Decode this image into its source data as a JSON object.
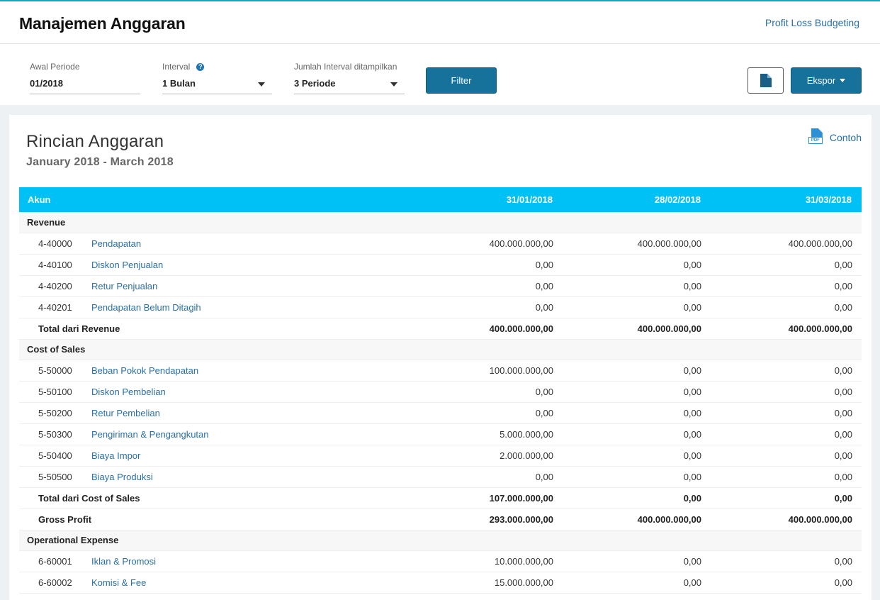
{
  "header": {
    "title": "Manajemen Anggaran",
    "link": "Profit Loss Budgeting"
  },
  "filters": {
    "awal_periode": {
      "label": "Awal Periode",
      "value": "01/2018"
    },
    "interval": {
      "label": "Interval",
      "value": "1 Bulan"
    },
    "jumlah_interval": {
      "label": "Jumlah Interval ditampilkan",
      "value": "3 Periode"
    },
    "filter_button": "Filter",
    "export_button": "Ekspor"
  },
  "report": {
    "title": "Rincian Anggaran",
    "subtitle": "January 2018 - March 2018",
    "sample_link": "Contoh",
    "columns": [
      "Akun",
      "31/01/2018",
      "28/02/2018",
      "31/03/2018"
    ],
    "sections": [
      {
        "name": "Revenue",
        "rows": [
          {
            "code": "4-40000",
            "name": "Pendapatan",
            "values": [
              "400.000.000,00",
              "400.000.000,00",
              "400.000.000,00"
            ]
          },
          {
            "code": "4-40100",
            "name": "Diskon Penjualan",
            "values": [
              "0,00",
              "0,00",
              "0,00"
            ]
          },
          {
            "code": "4-40200",
            "name": "Retur Penjualan",
            "values": [
              "0,00",
              "0,00",
              "0,00"
            ]
          },
          {
            "code": "4-40201",
            "name": "Pendapatan Belum Ditagih",
            "values": [
              "0,00",
              "0,00",
              "0,00"
            ]
          }
        ],
        "total": {
          "label": "Total dari Revenue",
          "values": [
            "400.000.000,00",
            "400.000.000,00",
            "400.000.000,00"
          ]
        }
      },
      {
        "name": "Cost of Sales",
        "rows": [
          {
            "code": "5-50000",
            "name": "Beban Pokok Pendapatan",
            "values": [
              "100.000.000,00",
              "0,00",
              "0,00"
            ]
          },
          {
            "code": "5-50100",
            "name": "Diskon Pembelian",
            "values": [
              "0,00",
              "0,00",
              "0,00"
            ]
          },
          {
            "code": "5-50200",
            "name": "Retur Pembelian",
            "values": [
              "0,00",
              "0,00",
              "0,00"
            ]
          },
          {
            "code": "5-50300",
            "name": "Pengiriman & Pengangkutan",
            "values": [
              "5.000.000,00",
              "0,00",
              "0,00"
            ]
          },
          {
            "code": "5-50400",
            "name": "Biaya Impor",
            "values": [
              "2.000.000,00",
              "0,00",
              "0,00"
            ]
          },
          {
            "code": "5-50500",
            "name": "Biaya Produksi",
            "values": [
              "0,00",
              "0,00",
              "0,00"
            ]
          }
        ],
        "total": {
          "label": "Total dari Cost of Sales",
          "values": [
            "107.000.000,00",
            "0,00",
            "0,00"
          ]
        }
      }
    ],
    "gross_profit": {
      "label": "Gross Profit",
      "values": [
        "293.000.000,00",
        "400.000.000,00",
        "400.000.000,00"
      ]
    },
    "operational_expense": {
      "name": "Operational Expense",
      "rows": [
        {
          "code": "6-60001",
          "name": "Iklan & Promosi",
          "values": [
            "10.000.000,00",
            "0,00",
            "0,00"
          ]
        },
        {
          "code": "6-60002",
          "name": "Komisi & Fee",
          "values": [
            "15.000.000,00",
            "0,00",
            "0,00"
          ]
        }
      ]
    }
  }
}
